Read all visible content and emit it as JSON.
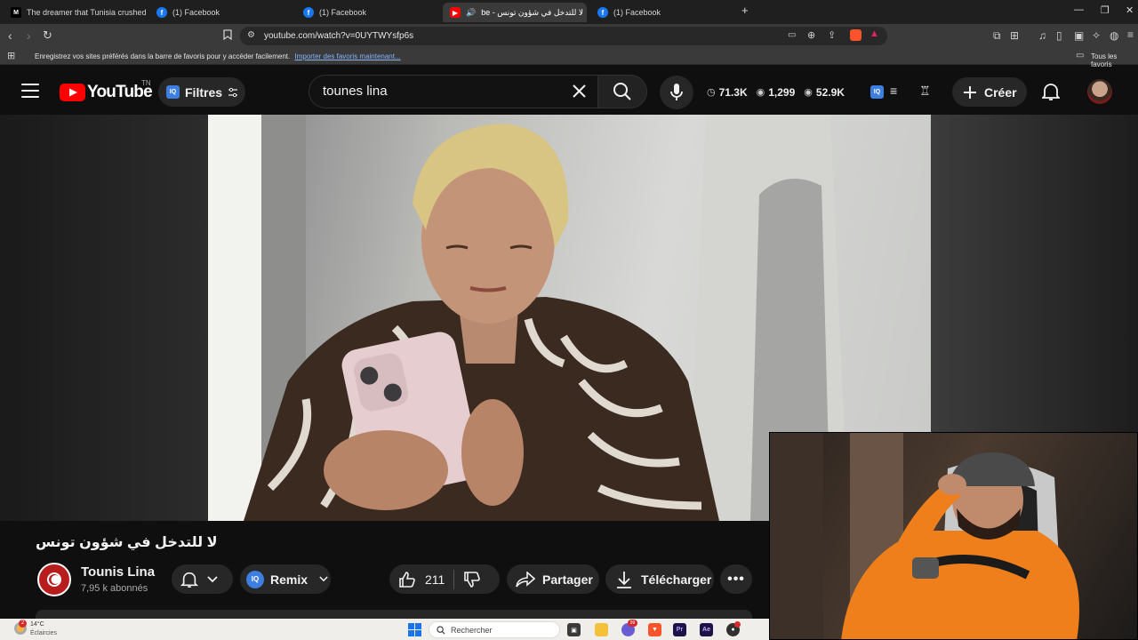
{
  "browser": {
    "tabs": [
      {
        "title": "The dreamer that Tunisia crushed. Th",
        "icon": "medium-icon",
        "active": false
      },
      {
        "title": "(1) Facebook",
        "icon": "facebook-icon",
        "active": false
      },
      {
        "title": "(1) Facebook",
        "icon": "facebook-icon",
        "active": false
      },
      {
        "title": "be - لا للتدخل في شؤون تونس",
        "icon": "youtube-icon",
        "active": true
      },
      {
        "title": "(1) Facebook",
        "icon": "facebook-icon",
        "active": false
      }
    ],
    "url": "youtube.com/watch?v=0UYTWYsfp6s",
    "bookmarks_prompt": "Enregistrez vos sites préférés dans la barre de favoris pour y accéder facilement.",
    "bookmarks_import_link": "Importer des favoris maintenant...",
    "bookmarks_all": "Tous les favoris"
  },
  "youtube": {
    "logo_text": "YouTube",
    "logo_country": "TN",
    "filters_label": "Filtres",
    "iq_badge": "IQ",
    "search_value": "tounes lina",
    "stats": [
      {
        "icon": "clock-icon",
        "value": "71.3K"
      },
      {
        "icon": "eye-icon",
        "value": "1,299"
      },
      {
        "icon": "eye-icon",
        "value": "52.9K"
      }
    ],
    "create_label": "Créer",
    "accent": "#ff0000"
  },
  "video": {
    "title": "لا للتدخل في شؤون تونس",
    "channel_name": "Tounis Lina",
    "channel_subs": "7,95 k abonnés",
    "remix_label": "Remix",
    "like_count": "211",
    "share_label": "Partager",
    "download_label": "Télécharger"
  },
  "taskbar": {
    "weather_temp": "14°C",
    "weather_desc": "Éclaircies",
    "weather_badge": "2",
    "search_placeholder": "Rechercher",
    "chat_badge": "99"
  }
}
